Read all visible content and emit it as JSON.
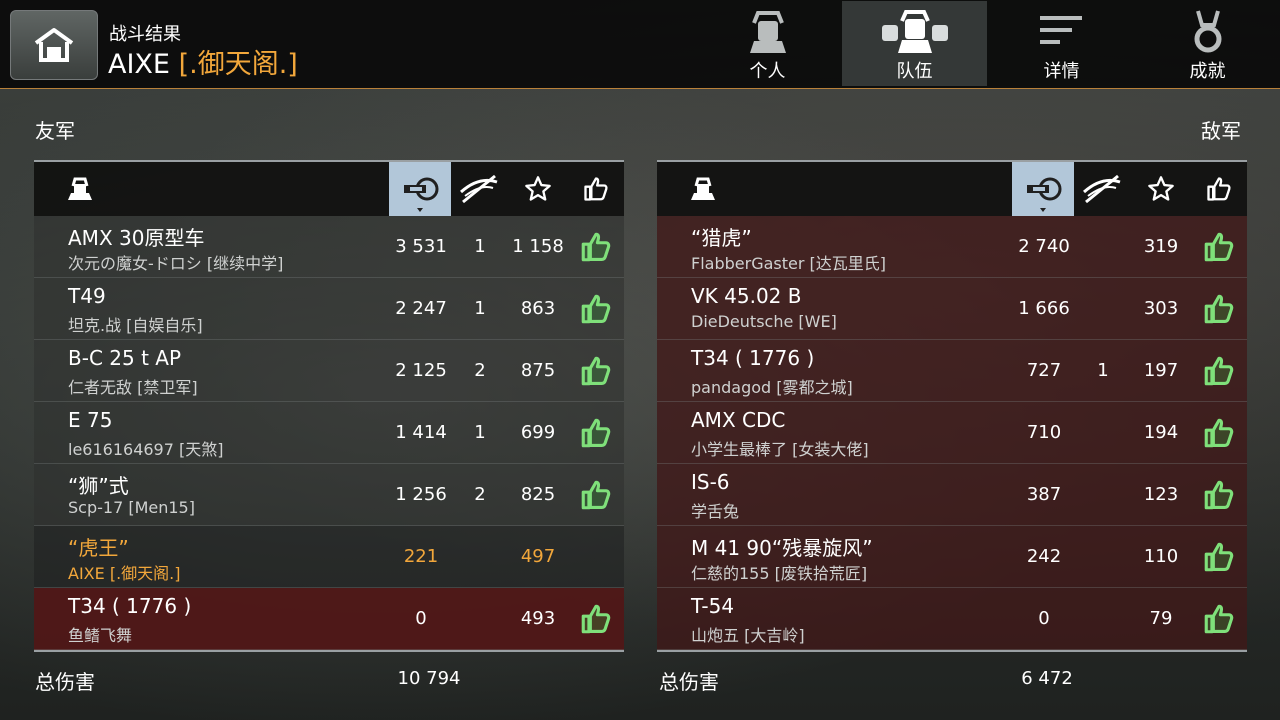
{
  "header": {
    "title": "战斗结果",
    "player": "AIXE",
    "clan": "[.御天阁.]",
    "tabs": [
      {
        "label": "个人",
        "icon": "soldier-icon"
      },
      {
        "label": "队伍",
        "icon": "squad-icon",
        "active": true
      },
      {
        "label": "详情",
        "icon": "details-icon"
      },
      {
        "label": "成就",
        "icon": "medal-icon"
      }
    ]
  },
  "allies": {
    "title": "友军",
    "total_label": "总伤害",
    "total_damage": "10 794",
    "rows": [
      {
        "tank": "AMX 30原型车",
        "player": "次元の魔女-ドロシ [继续中学]",
        "damage": "3 531",
        "kills": "1",
        "xp": "1 158",
        "thumb": true
      },
      {
        "tank": "T49",
        "player": "坦克.战 [自娱自乐]",
        "damage": "2 247",
        "kills": "1",
        "xp": "863",
        "thumb": true
      },
      {
        "tank": "B-C 25 t AP",
        "player": "仁者无敌 [禁卫军]",
        "damage": "2 125",
        "kills": "2",
        "xp": "875",
        "thumb": true
      },
      {
        "tank": "E 75",
        "player": "le616164697 [天煞]",
        "damage": "1 414",
        "kills": "1",
        "xp": "699",
        "thumb": true
      },
      {
        "tank": "“狮”式",
        "player": "Scp-17 [Men15]",
        "damage": "1 256",
        "kills": "2",
        "xp": "825",
        "thumb": true
      },
      {
        "tank": "“虎王”",
        "player": "AIXE [.御天阁.]",
        "damage": "221",
        "kills": "",
        "xp": "497",
        "thumb": false,
        "me": true
      },
      {
        "tank": "T34 ( 1776 )",
        "player": "鱼鳍飞舞",
        "damage": "0",
        "kills": "",
        "xp": "493",
        "thumb": true,
        "destroyed": true
      }
    ]
  },
  "enemies": {
    "title": "敌军",
    "total_label": "总伤害",
    "total_damage": "6 472",
    "rows": [
      {
        "tank": "“猎虎”",
        "player": "FlabberGaster [达瓦里氏]",
        "damage": "2 740",
        "kills": "",
        "xp": "319",
        "thumb": true
      },
      {
        "tank": "VK 45.02 B",
        "player": "DieDeutsche [WE]",
        "damage": "1 666",
        "kills": "",
        "xp": "303",
        "thumb": true
      },
      {
        "tank": "T34 ( 1776 )",
        "player": "pandagod [雾都之城]",
        "damage": "727",
        "kills": "1",
        "xp": "197",
        "thumb": true
      },
      {
        "tank": "AMX CDC",
        "player": "小学生最棒了 [女装大佬]",
        "damage": "710",
        "kills": "",
        "xp": "194",
        "thumb": true
      },
      {
        "tank": "IS-6",
        "player": "学舌兔",
        "damage": "387",
        "kills": "",
        "xp": "123",
        "thumb": true
      },
      {
        "tank": "M 41 90“残暴旋风”",
        "player": "仁慈的155 [废铁拾荒匠]",
        "damage": "242",
        "kills": "",
        "xp": "110",
        "thumb": true
      },
      {
        "tank": "T-54",
        "player": "山炮五 [大吉岭]",
        "damage": "0",
        "kills": "",
        "xp": "79",
        "thumb": true
      }
    ]
  },
  "columns": [
    {
      "id": "tank",
      "icon": "tank-icon"
    },
    {
      "id": "damage",
      "icon": "damage-icon",
      "sorted": true
    },
    {
      "id": "kills",
      "icon": "kills-icon"
    },
    {
      "id": "xp",
      "icon": "star-icon"
    },
    {
      "id": "rating",
      "icon": "thumbs-up-icon"
    }
  ],
  "colors": {
    "accent": "#f2a73b",
    "sorted_column": "#b2c7d9",
    "thumb_green": "#7fe07a"
  }
}
